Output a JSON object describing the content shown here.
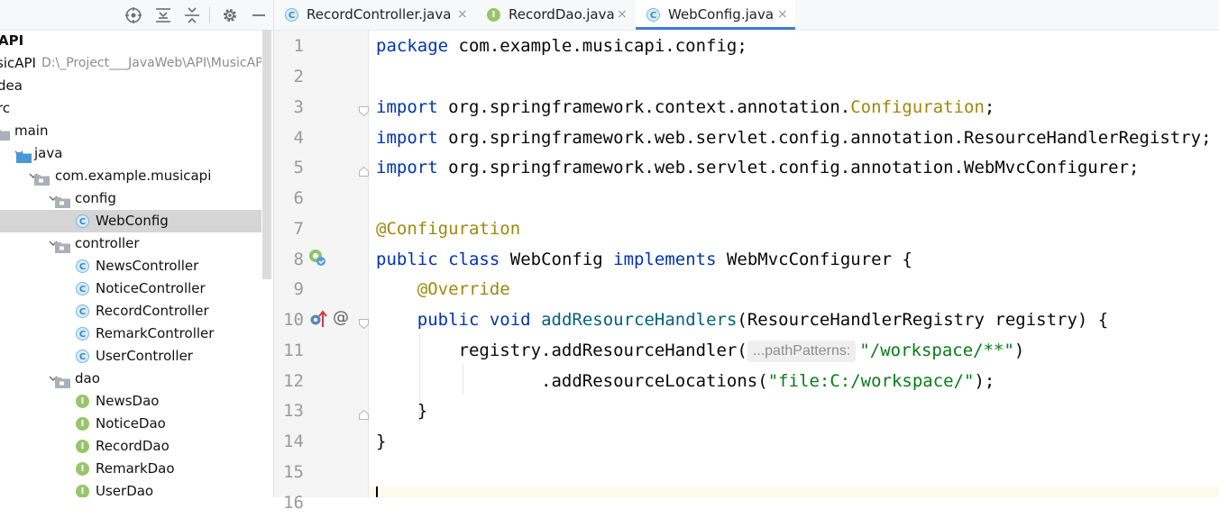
{
  "project_panel": {
    "toolbar": {
      "icons": [
        "crosshair-icon",
        "expand-all-icon",
        "collapse-all-icon",
        "gear-icon",
        "minimize-icon"
      ]
    },
    "tree": [
      {
        "label": "API",
        "path": "",
        "indent": 0,
        "icon": "none",
        "arrow": "none",
        "bold": true
      },
      {
        "label": "sicAPI",
        "path": "D:\\_Project___JavaWeb\\API\\MusicAPI",
        "icon": "none",
        "arrow": "none"
      },
      {
        "label": "dea",
        "path": "",
        "icon": "none",
        "arrow": "none"
      },
      {
        "label": "rc",
        "path": "",
        "icon": "none",
        "arrow": "none"
      },
      {
        "label": "main",
        "path": "",
        "icon": "folder",
        "arrow": "none"
      },
      {
        "label": "java",
        "path": "",
        "icon": "folder-blue",
        "arrow": "down"
      },
      {
        "label": "com.example.musicapi",
        "path": "",
        "icon": "package",
        "arrow": "down"
      },
      {
        "label": "config",
        "path": "",
        "icon": "package",
        "arrow": "down"
      },
      {
        "label": "WebConfig",
        "path": "",
        "icon": "class",
        "arrow": "none",
        "selected": true
      },
      {
        "label": "controller",
        "path": "",
        "icon": "package",
        "arrow": "down"
      },
      {
        "label": "NewsController",
        "path": "",
        "icon": "class",
        "arrow": "none"
      },
      {
        "label": "NoticeController",
        "path": "",
        "icon": "class",
        "arrow": "none"
      },
      {
        "label": "RecordController",
        "path": "",
        "icon": "class",
        "arrow": "none"
      },
      {
        "label": "RemarkController",
        "path": "",
        "icon": "class",
        "arrow": "none"
      },
      {
        "label": "UserController",
        "path": "",
        "icon": "class",
        "arrow": "none"
      },
      {
        "label": "dao",
        "path": "",
        "icon": "package",
        "arrow": "down"
      },
      {
        "label": "NewsDao",
        "path": "",
        "icon": "interface",
        "arrow": "none"
      },
      {
        "label": "NoticeDao",
        "path": "",
        "icon": "interface",
        "arrow": "none"
      },
      {
        "label": "RecordDao",
        "path": "",
        "icon": "interface",
        "arrow": "none"
      },
      {
        "label": "RemarkDao",
        "path": "",
        "icon": "interface",
        "arrow": "none"
      },
      {
        "label": "UserDao",
        "path": "",
        "icon": "interface",
        "arrow": "none"
      }
    ]
  },
  "tabs": [
    {
      "label": "RecordController.java",
      "icon": "class",
      "icon_letter": "C",
      "active": false,
      "close": "×"
    },
    {
      "label": "RecordDao.java",
      "icon": "interface",
      "icon_letter": "I",
      "active": false,
      "close": "×"
    },
    {
      "label": "WebConfig.java",
      "icon": "class",
      "icon_letter": "C",
      "active": true,
      "close": "×"
    }
  ],
  "editor": {
    "line_numbers": [
      "1",
      "2",
      "3",
      "4",
      "5",
      "6",
      "7",
      "8",
      "9",
      "10",
      "11",
      "12",
      "13",
      "14",
      "15",
      "16"
    ],
    "code": [
      {
        "kw1": "package",
        "rest": " com.example.musicapi.config;"
      },
      {
        "text": ""
      },
      {
        "kw1": "import",
        "rest": " org.springframework.context.annotation.",
        "ann": "Configuration",
        "tail": ";"
      },
      {
        "kw1": "import",
        "rest": " org.springframework.web.servlet.config.annotation.ResourceHandlerRegistry;"
      },
      {
        "kw1": "import",
        "rest": " org.springframework.web.servlet.config.annotation.WebMvcConfigurer;"
      },
      {
        "text": ""
      },
      {
        "ann": "@Configuration"
      },
      {
        "kw1": "public",
        "kw2": "class",
        "name": "WebConfig",
        "kw3": "implements",
        "tail": " WebMvcConfigurer {"
      },
      {
        "ann": "@Override"
      },
      {
        "kw1": "public",
        "kw2": "void",
        "fn": "addResourceHandlers",
        "tail": "(ResourceHandlerRegistry registry) {"
      },
      {
        "pre": "registry.addResourceHandler(",
        "hint": "...pathPatterns:",
        "str": "\"/workspace/**\"",
        "tail": ")"
      },
      {
        "pre": ".addResourceLocations(",
        "str": "\"file:C:/workspace/\"",
        "tail": ");"
      },
      {
        "text": "}"
      },
      {
        "text": "}"
      },
      {
        "text": ""
      }
    ],
    "gutter_icons": [
      "implements-icon",
      "override-icon",
      "annotation-at-icon"
    ]
  }
}
